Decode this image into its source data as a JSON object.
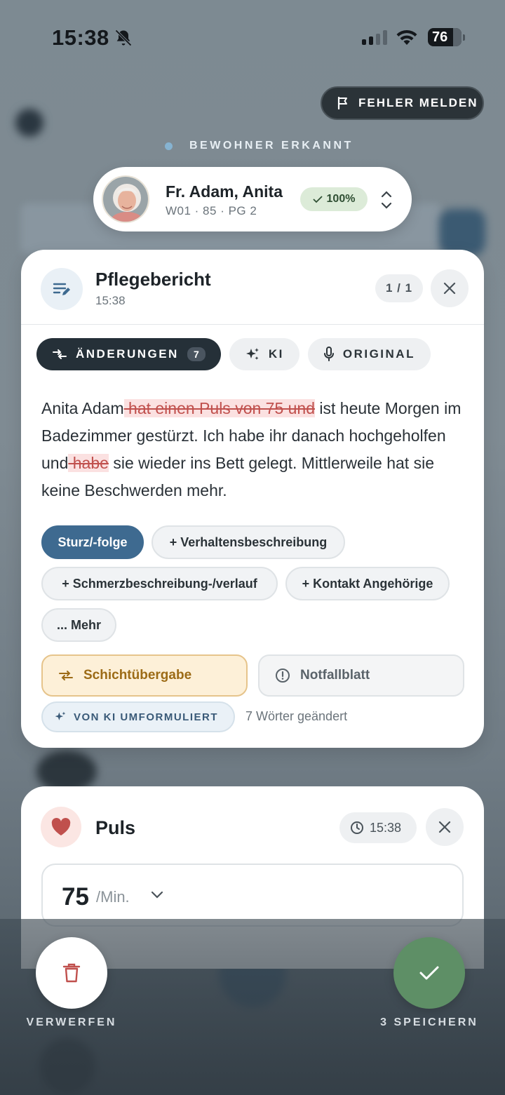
{
  "status_bar": {
    "time": "15:38",
    "battery": "76"
  },
  "report_button": {
    "label": "FEHLER MELDEN"
  },
  "recognition": {
    "label": "BEWOHNER ERKANNT"
  },
  "resident": {
    "name": "Fr. Adam, Anita",
    "details": "W01 · 85 · PG 2",
    "match": "100%"
  },
  "report_card": {
    "title": "Pflegebericht",
    "time": "15:38",
    "pager": "1 / 1",
    "tabs": [
      {
        "label": "ÄNDERUNGEN",
        "count": "7",
        "active": true
      },
      {
        "label": "KI",
        "active": false
      },
      {
        "label": "ORIGINAL",
        "active": false
      }
    ],
    "text": {
      "seg1": "Anita Adam",
      "del1": " hat einen Puls von 75 und",
      "seg2": " ist heute Morgen im Badezimmer gestürzt. Ich habe ihr danach hochgeholfen und",
      "del2": " habe",
      "seg3": " sie wieder ins Bett gelegt. Mittlerweile hat sie keine Beschwerden mehr."
    },
    "tags": [
      {
        "label": "Sturz/-folge",
        "selected": true
      },
      {
        "label": "+ Verhaltensbeschreibung",
        "selected": false
      },
      {
        "label": "+ Schmerzbeschreibung-/verlauf",
        "selected": false
      },
      {
        "label": "+ Kontakt Angehörige",
        "selected": false
      },
      {
        "label": "... Mehr",
        "selected": false
      }
    ],
    "shift_handover": "Schichtübergabe",
    "emergency": "Notfallblatt",
    "ki_badge": "VON KI UMFORMULIERT",
    "changed_words": "7 Wörter geändert"
  },
  "pulse_card": {
    "title": "Puls",
    "time": "15:38",
    "value": "75",
    "unit": "/Min."
  },
  "actions": {
    "discard": "VERWERFEN",
    "save": "3 SPEICHERN"
  },
  "colors": {
    "accent_blue": "#3e6a90",
    "save_green": "#5e8f66",
    "delete_red": "#c0504d",
    "shift_amber": "#9c6b16"
  }
}
